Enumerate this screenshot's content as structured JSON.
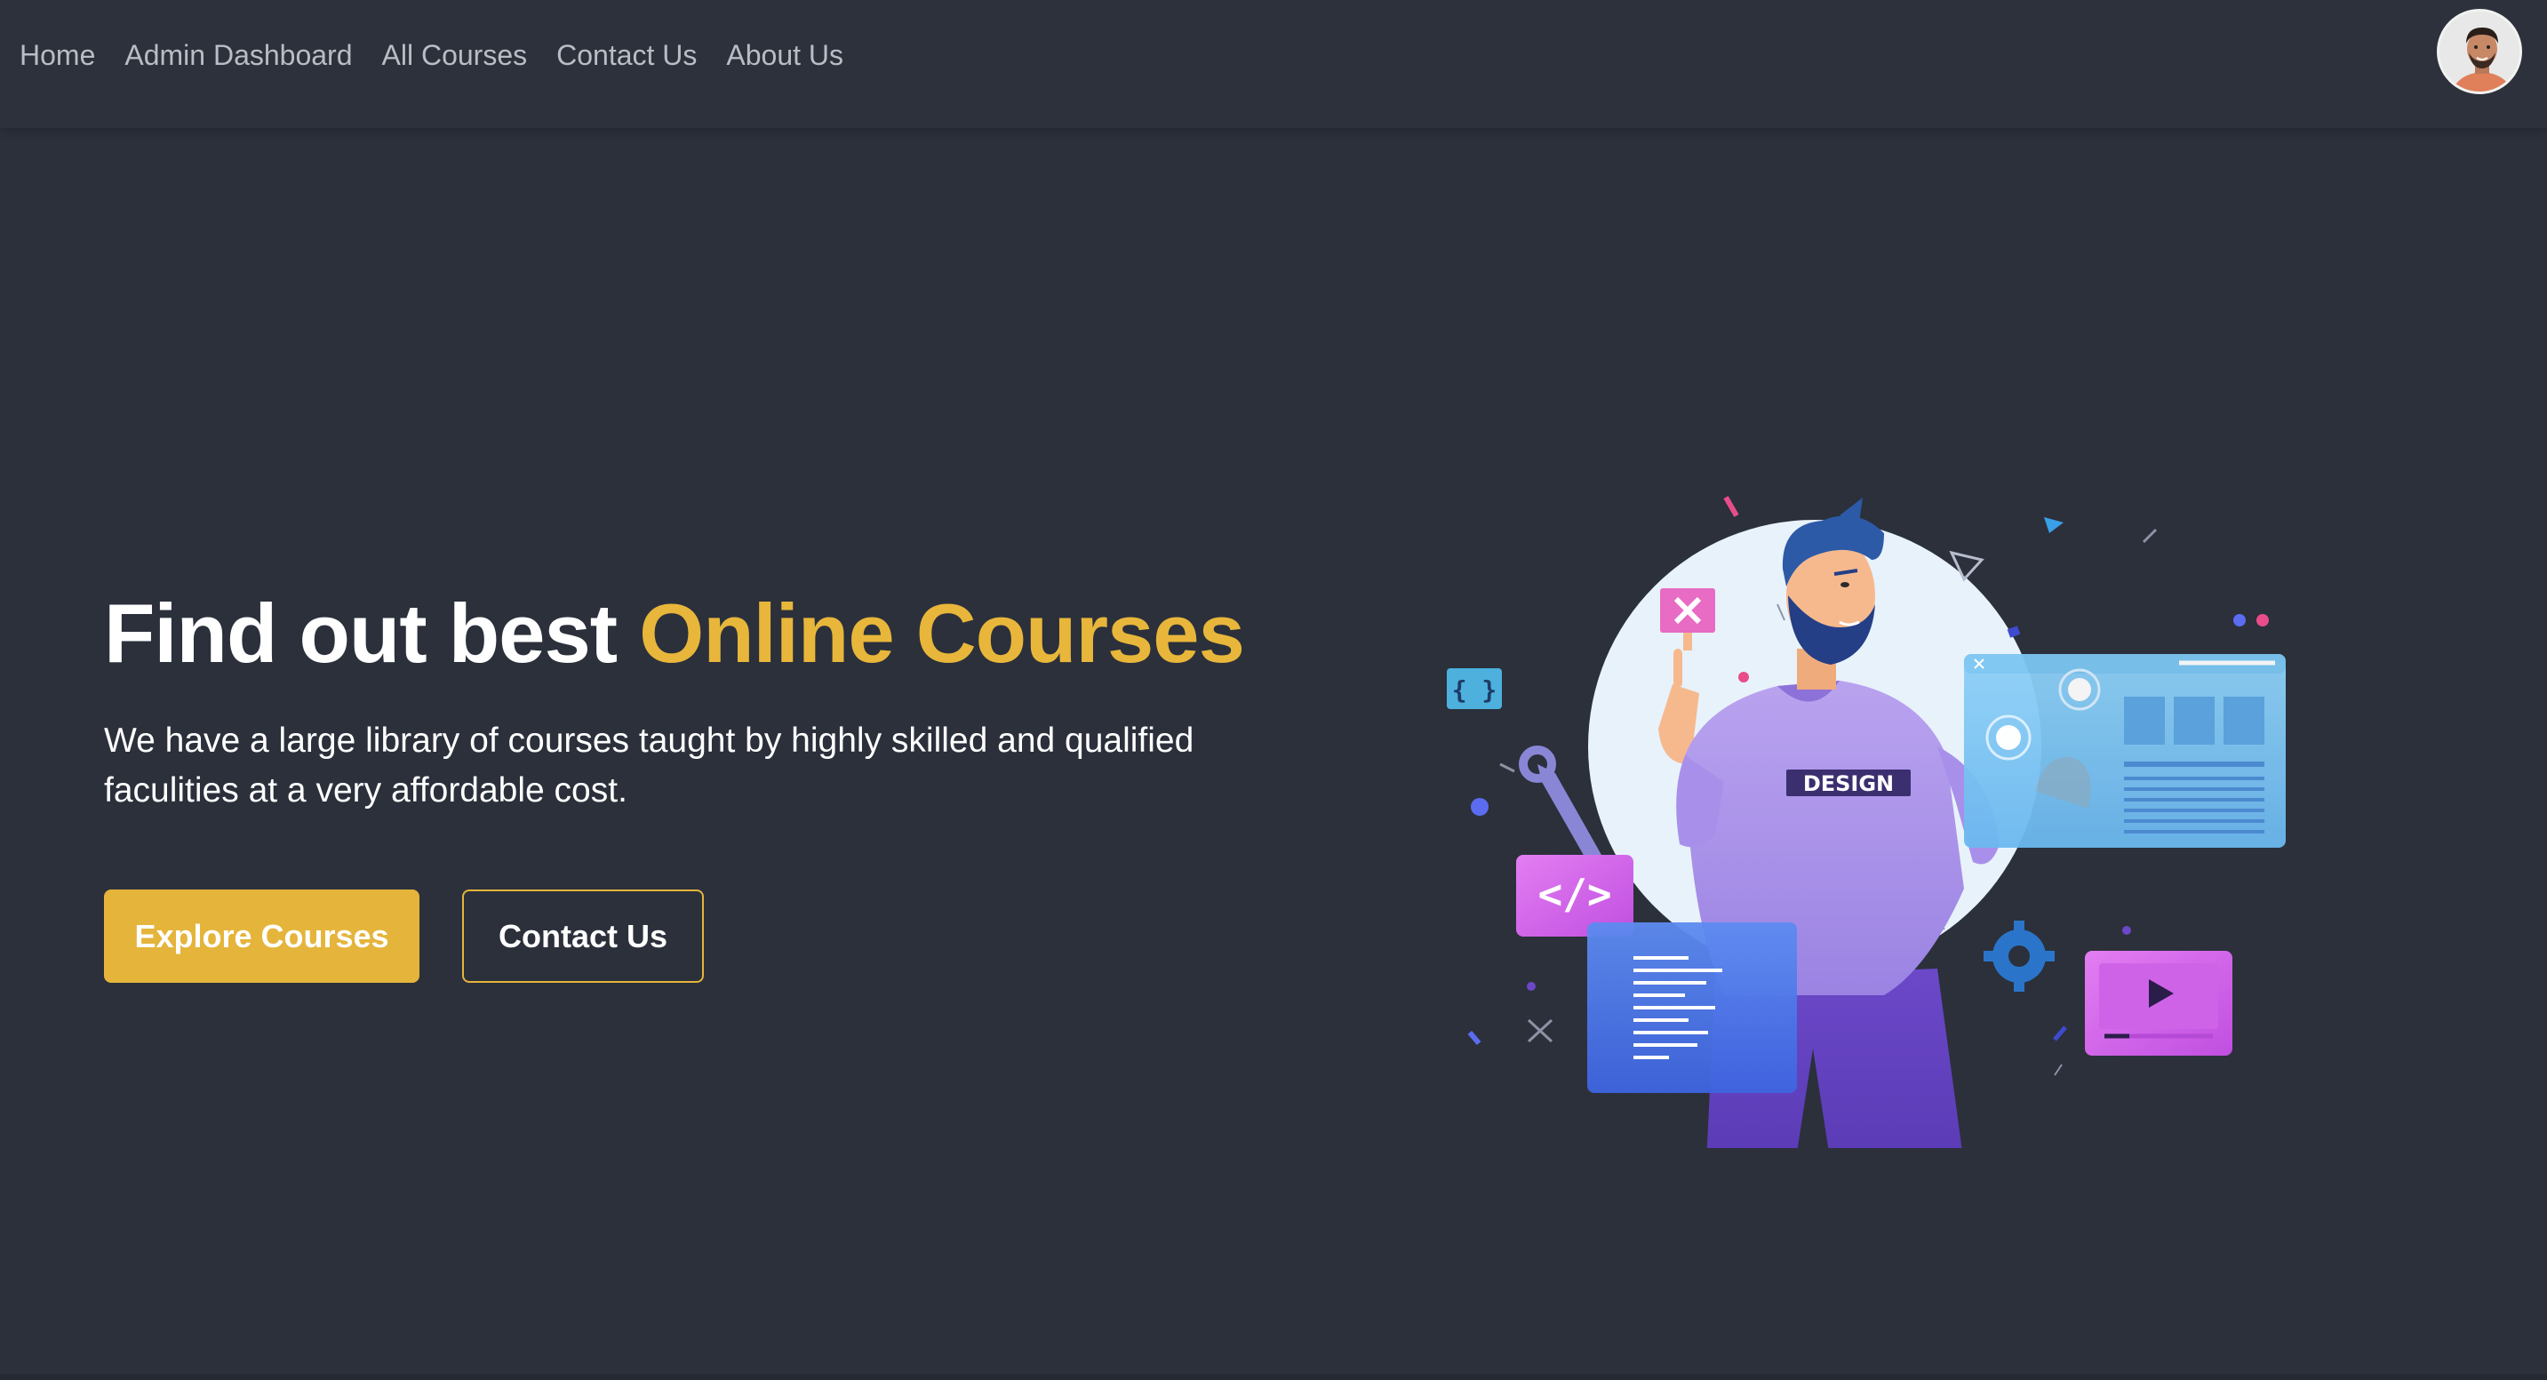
{
  "nav": {
    "links": [
      "Home",
      "Admin Dashboard",
      "All Courses",
      "Contact Us",
      "About Us"
    ]
  },
  "hero": {
    "title_plain": "Find out best ",
    "title_accent": "Online Courses",
    "description": "We have a large library of courses taught by highly skilled and qualified faculities at a very affordable cost.",
    "primary_button": "Explore Courses",
    "secondary_button": "Contact Us"
  },
  "illustration": {
    "shirt_label": "DESIGN",
    "code_tag": "</>",
    "braces": "{ }"
  },
  "colors": {
    "background": "#2b303b",
    "accent": "#e8b63a",
    "nav_text": "#b9bdc4"
  },
  "icons": {
    "avatar": "user-avatar",
    "play": "play-icon",
    "close": "close-icon",
    "gear": "gear-icon",
    "wrench": "wrench-icon"
  }
}
